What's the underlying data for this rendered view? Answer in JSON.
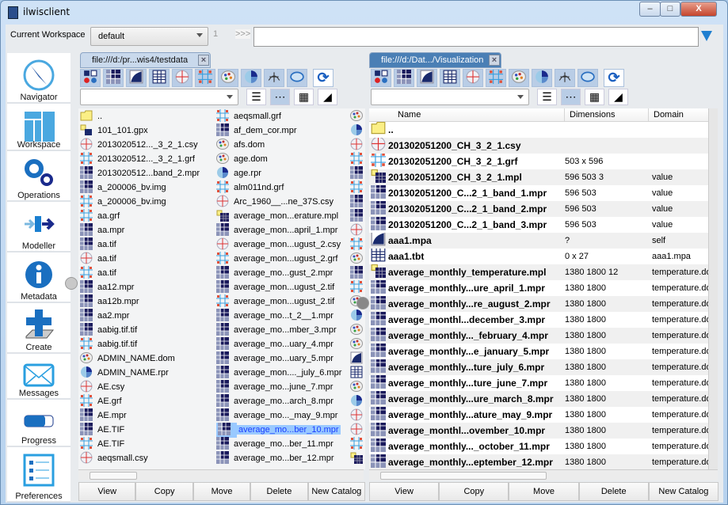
{
  "window": {
    "title": "ilwisclient",
    "controls": [
      "minimize",
      "maximize",
      "close"
    ]
  },
  "toolbar": {
    "workspace_label": "Current Workspace",
    "workspace_value": "default",
    "counter": "1",
    "prompt": ">>>",
    "command_value": ""
  },
  "sidebar": {
    "items": [
      {
        "label": "Navigator",
        "icon": "compass-icon"
      },
      {
        "label": "Workspace",
        "icon": "workspace-icon"
      },
      {
        "label": "Operations",
        "icon": "gears-icon"
      },
      {
        "label": "Modeller",
        "icon": "modeller-icon"
      },
      {
        "label": "Metadata",
        "icon": "info-icon"
      },
      {
        "label": "Create",
        "icon": "create-icon"
      },
      {
        "label": "Messages",
        "icon": "envelope-icon"
      },
      {
        "label": "Progress",
        "icon": "progress-icon"
      },
      {
        "label": "Preferences",
        "icon": "list-icon"
      }
    ]
  },
  "filter_icons": [
    "all-objects",
    "raster",
    "feature",
    "table",
    "coordinate-system",
    "georeference",
    "domain",
    "representation",
    "projection",
    "ellipsoid"
  ],
  "view_icons": [
    "list-view",
    "icon-view",
    "small-icons",
    "thumbnail"
  ],
  "buttons": [
    "View",
    "Copy",
    "Move",
    "Delete",
    "New Catalog"
  ],
  "left_pane": {
    "tab": "file:///d:/pr...wis4/testdata",
    "filter_value": "",
    "selected": "average_mo...ber_10.mpr",
    "columns": [
      [
        [
          "folder",
          ".."
        ],
        [
          "gpx",
          "101_101.gpx"
        ],
        [
          "csy",
          "2013020512..._3_2_1.csy"
        ],
        [
          "grf",
          "2013020512..._3_2_1.grf"
        ],
        [
          "mpr",
          "2013020512...band_2.mpr"
        ],
        [
          "mpr",
          "a_200006_bv.img"
        ],
        [
          "grf",
          "a_200006_bv.img"
        ],
        [
          "grf",
          "aa.grf"
        ],
        [
          "mpr",
          "aa.mpr"
        ],
        [
          "mpr",
          "aa.tif"
        ],
        [
          "csy",
          "aa.tif"
        ],
        [
          "grf",
          "aa.tif"
        ],
        [
          "mpr",
          "aa12.mpr"
        ],
        [
          "mpr",
          "aa12b.mpr"
        ],
        [
          "mpr",
          "aa2.mpr"
        ],
        [
          "mpr",
          "aabig.tif.tif"
        ],
        [
          "grf",
          "aabig.tif.tif"
        ],
        [
          "dom",
          "ADMIN_NAME.dom"
        ],
        [
          "rpr",
          "ADMIN_NAME.rpr"
        ],
        [
          "csy",
          "AE.csy"
        ],
        [
          "grf",
          "AE.grf"
        ],
        [
          "mpr",
          "AE.mpr"
        ],
        [
          "mpr",
          "AE.TIF"
        ],
        [
          "grf",
          "AE.TIF"
        ],
        [
          "csy",
          "aeqsmall.csy"
        ]
      ],
      [
        [
          "grf",
          "aeqsmall.grf"
        ],
        [
          "mpr",
          "af_dem_cor.mpr"
        ],
        [
          "dom",
          "afs.dom"
        ],
        [
          "dom",
          "age.dom"
        ],
        [
          "rpr",
          "age.rpr"
        ],
        [
          "grf",
          "alm011nd.grf"
        ],
        [
          "csy",
          "Arc_1960__...ne_37S.csy"
        ],
        [
          "mpl",
          "average_mon...erature.mpl"
        ],
        [
          "mpr",
          "average_mon...april_1.mpr"
        ],
        [
          "csy",
          "average_mon...ugust_2.csy"
        ],
        [
          "grf",
          "average_mon...ugust_2.grf"
        ],
        [
          "mpr",
          "average_mo...gust_2.mpr"
        ],
        [
          "mpr",
          "average_mon...ugust_2.tif"
        ],
        [
          "grf",
          "average_mon...ugust_2.tif"
        ],
        [
          "mpr",
          "average_mo...t_2__1.mpr"
        ],
        [
          "mpr",
          "average_mo...mber_3.mpr"
        ],
        [
          "mpr",
          "average_mo...uary_4.mpr"
        ],
        [
          "mpr",
          "average_mo...uary_5.mpr"
        ],
        [
          "mpr",
          "average_mon...._july_6.mpr"
        ],
        [
          "mpr",
          "average_mo...june_7.mpr"
        ],
        [
          "mpr",
          "average_mo...arch_8.mpr"
        ],
        [
          "mpr",
          "average_mo..._may_9.mpr"
        ],
        [
          "mpr",
          "average_mo...ber_10.mpr"
        ],
        [
          "mpr",
          "average_mo...ber_11.mpr"
        ],
        [
          "mpr",
          "average_mo...ber_12.mpr"
        ]
      ],
      [
        [
          "dom",
          ""
        ],
        [
          "rpr",
          ""
        ],
        [
          "csy",
          ""
        ],
        [
          "grf",
          ""
        ],
        [
          "mpr",
          ""
        ],
        [
          "grf",
          ""
        ],
        [
          "mpr",
          ""
        ],
        [
          "mpr",
          ""
        ],
        [
          "csy",
          ""
        ],
        [
          "grf",
          ""
        ],
        [
          "dom",
          ""
        ],
        [
          "mpr",
          ""
        ],
        [
          "grf",
          ""
        ],
        [
          "dom",
          ""
        ],
        [
          "rpr",
          ""
        ],
        [
          "dom",
          ""
        ],
        [
          "dom",
          ""
        ],
        [
          "mpa",
          ""
        ],
        [
          "tbt",
          ""
        ],
        [
          "dom",
          ""
        ],
        [
          "rpr",
          ""
        ],
        [
          "csy",
          ""
        ],
        [
          "csy",
          ""
        ],
        [
          "grf",
          ""
        ],
        [
          "mpl",
          ""
        ]
      ]
    ]
  },
  "right_pane": {
    "tab": "file:///d:/Dat.../Visualization",
    "filter_value": "",
    "headers": [
      "Name",
      "Dimensions",
      "Domain"
    ],
    "rows": [
      [
        "folder",
        "..",
        "",
        ""
      ],
      [
        "csy",
        "201302051200_CH_3_2_1.csy",
        "",
        ""
      ],
      [
        "grf",
        "201302051200_CH_3_2_1.grf",
        "503 x 596",
        ""
      ],
      [
        "mpl",
        "201302051200_CH_3_2_1.mpl",
        "596 503 3",
        "value"
      ],
      [
        "mpr",
        "201302051200_C...2_1_band_1.mpr",
        "596 503",
        "value"
      ],
      [
        "mpr",
        "201302051200_C...2_1_band_2.mpr",
        "596 503",
        "value"
      ],
      [
        "mpr",
        "201302051200_C...2_1_band_3.mpr",
        "596 503",
        "value"
      ],
      [
        "mpa",
        "aaa1.mpa",
        "?",
        "self"
      ],
      [
        "tbt",
        "aaa1.tbt",
        "0 x 27",
        "aaa1.mpa"
      ],
      [
        "mpl",
        "average_monthly_temperature.mpl",
        "1380 1800 12",
        "temperature.do"
      ],
      [
        "mpr",
        "average_monthly...ure_april_1.mpr",
        "1380 1800",
        "temperature.do"
      ],
      [
        "mpr",
        "average_monthly...re_august_2.mpr",
        "1380 1800",
        "temperature.do"
      ],
      [
        "mpr",
        "average_monthl...december_3.mpr",
        "1380 1800",
        "temperature.do"
      ],
      [
        "mpr",
        "average_monthly..._february_4.mpr",
        "1380 1800",
        "temperature.do"
      ],
      [
        "mpr",
        "average_monthly...e_january_5.mpr",
        "1380 1800",
        "temperature.do"
      ],
      [
        "mpr",
        "average_monthly...ture_july_6.mpr",
        "1380 1800",
        "temperature.do"
      ],
      [
        "mpr",
        "average_monthly...ture_june_7.mpr",
        "1380 1800",
        "temperature.do"
      ],
      [
        "mpr",
        "average_monthly...ure_march_8.mpr",
        "1380 1800",
        "temperature.do"
      ],
      [
        "mpr",
        "average_monthly...ature_may_9.mpr",
        "1380 1800",
        "temperature.do"
      ],
      [
        "mpr",
        "average_monthl...ovember_10.mpr",
        "1380 1800",
        "temperature.do"
      ],
      [
        "mpr",
        "average_monthly..._october_11.mpr",
        "1380 1800",
        "temperature.do"
      ],
      [
        "mpr",
        "average_monthly...eptember_12.mpr",
        "1380 1800",
        "temperature.do"
      ]
    ]
  },
  "colors": {
    "accent": "#1f7fd0",
    "selected_tab": "#4a7fb5",
    "selection": "#99c9ff",
    "icon_dark": "#1a2a6c"
  }
}
